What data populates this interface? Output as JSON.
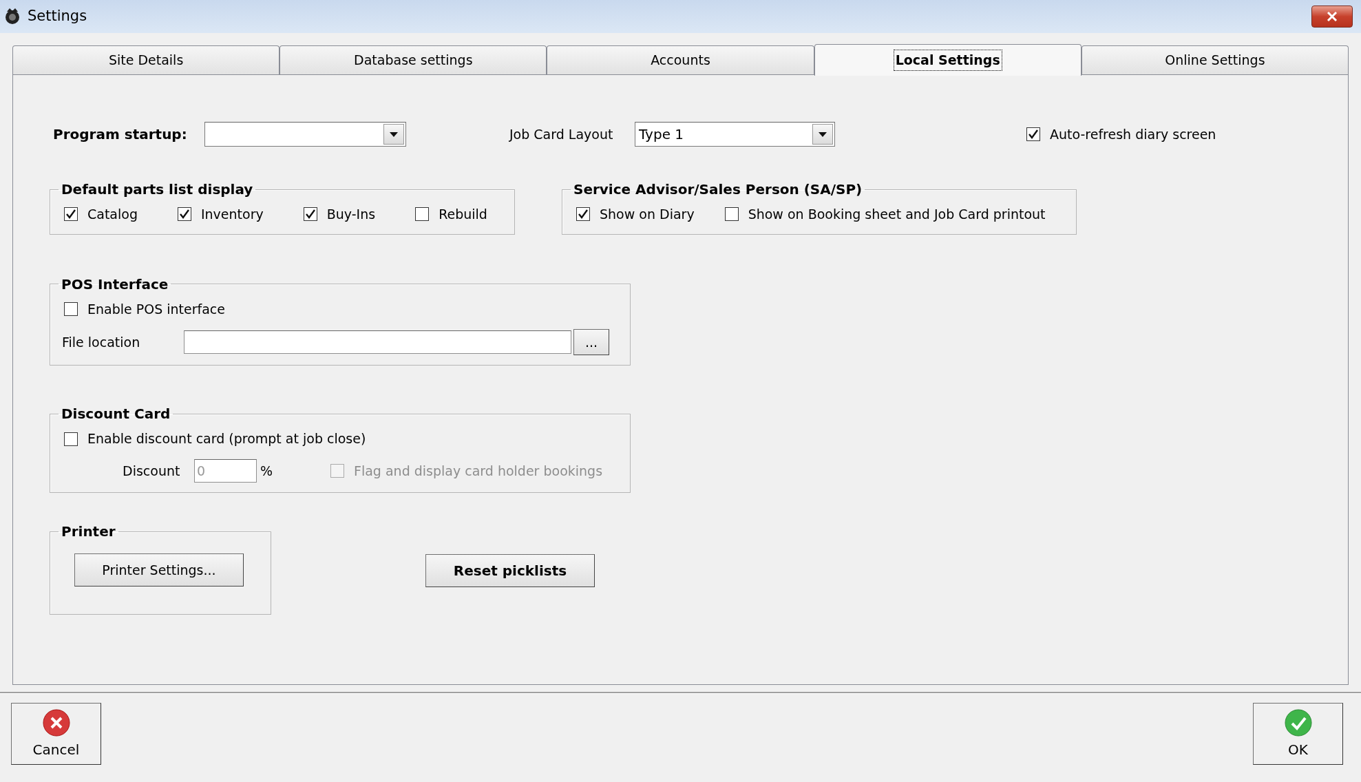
{
  "window": {
    "title": "Settings"
  },
  "tabs": [
    {
      "label": "Site Details",
      "selected": false
    },
    {
      "label": "Database settings",
      "selected": false
    },
    {
      "label": "Accounts",
      "selected": false
    },
    {
      "label": "Local Settings",
      "selected": true
    },
    {
      "label": "Online Settings",
      "selected": false
    }
  ],
  "program_startup": {
    "label": "Program startup:"
  },
  "job_card_layout": {
    "label": "Job Card Layout",
    "value": "Type 1"
  },
  "auto_refresh": {
    "label": "Auto-refresh diary screen",
    "checked": true
  },
  "parts_list": {
    "title": "Default parts list display",
    "options": [
      {
        "label": "Catalog",
        "checked": true
      },
      {
        "label": "Inventory",
        "checked": true
      },
      {
        "label": "Buy-Ins",
        "checked": true
      },
      {
        "label": "Rebuild",
        "checked": false
      }
    ]
  },
  "sa_sp": {
    "title": "Service Advisor/Sales Person (SA/SP)",
    "options": [
      {
        "label": "Show on Diary",
        "checked": true
      },
      {
        "label": "Show on Booking sheet and Job Card printout",
        "checked": false
      }
    ]
  },
  "pos": {
    "title": "POS Interface",
    "enable": {
      "label": "Enable POS interface",
      "checked": false
    },
    "file_location": {
      "label": "File location"
    },
    "browse_button": "..."
  },
  "discount_card": {
    "title": "Discount Card",
    "enable": {
      "label": "Enable discount card (prompt at job close)",
      "checked": false
    },
    "discount": {
      "label": "Discount",
      "value": "0",
      "unit": "%"
    },
    "flag": {
      "label": "Flag and display card holder bookings",
      "checked": false,
      "disabled": true
    }
  },
  "printer": {
    "title": "Printer",
    "button": "Printer Settings..."
  },
  "reset_button": "Reset picklists",
  "footer_buttons": [
    {
      "label": "Cancel",
      "kind": "cancel"
    },
    {
      "label": "OK",
      "kind": "ok"
    }
  ]
}
